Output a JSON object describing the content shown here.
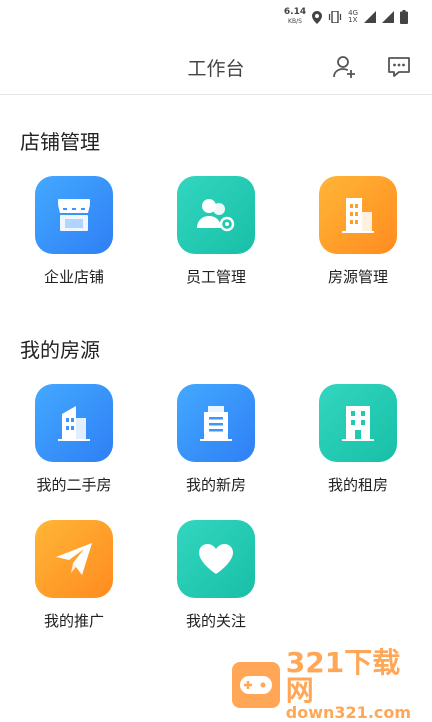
{
  "status_bar": {
    "speed_value": "6.14",
    "speed_unit": "KB/S",
    "net_top": "4G",
    "net_bottom": "1X",
    "icons": [
      "location-icon",
      "vibrate-icon",
      "signal-icon",
      "battery-icon"
    ]
  },
  "header": {
    "title": "工作台",
    "icons": [
      "add-user-icon",
      "message-icon"
    ]
  },
  "sections": [
    {
      "title": "店铺管理",
      "items": [
        {
          "label": "企业店铺",
          "icon": "store-icon",
          "color": "#3b96ff"
        },
        {
          "label": "员工管理",
          "icon": "staff-settings-icon",
          "color": "#22c9b1"
        },
        {
          "label": "房源管理",
          "icon": "building-icon",
          "color": "#ff9c2a"
        }
      ]
    },
    {
      "title": "我的房源",
      "items": [
        {
          "label": "我的二手房",
          "icon": "second-hand-house-icon",
          "color": "#3b96ff"
        },
        {
          "label": "我的新房",
          "icon": "new-house-icon",
          "color": "#3b96ff"
        },
        {
          "label": "我的租房",
          "icon": "rental-house-icon",
          "color": "#22c9b1"
        },
        {
          "label": "我的推广",
          "icon": "paper-plane-icon",
          "color": "#ff9c2a"
        },
        {
          "label": "我的关注",
          "icon": "heart-icon",
          "color": "#22c9b1"
        }
      ]
    }
  ],
  "watermark": {
    "brand": "321下载网",
    "domain": "down321.com"
  }
}
